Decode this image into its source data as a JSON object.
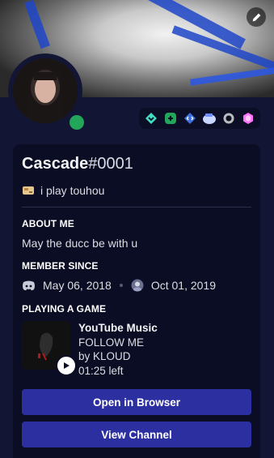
{
  "profile": {
    "username": "Cascade",
    "discriminator": "#0001",
    "custom_status": "i play touhou",
    "status_color": "#23a55a"
  },
  "badges": [
    "hypesquad-balance-icon",
    "nitro-boost-icon",
    "active-developer-icon",
    "early-supporter-icon",
    "nitro-icon",
    "boost-gem-icon"
  ],
  "about": {
    "title": "ABOUT ME",
    "text": "May the ducc be with u"
  },
  "member_since": {
    "title": "MEMBER SINCE",
    "discord_date": "May 06, 2018",
    "server_date": "Oct 01, 2019"
  },
  "activity": {
    "title": "PLAYING A GAME",
    "app": "YouTube Music",
    "track": "FOLLOW ME",
    "artist": "by KLOUD",
    "time_left": "01:25 left"
  },
  "buttons": {
    "open_browser": "Open in Browser",
    "view_channel": "View Channel"
  },
  "colors": {
    "accent": "#2b2fa0",
    "panel": "#0b0d24",
    "background": "#121634"
  }
}
